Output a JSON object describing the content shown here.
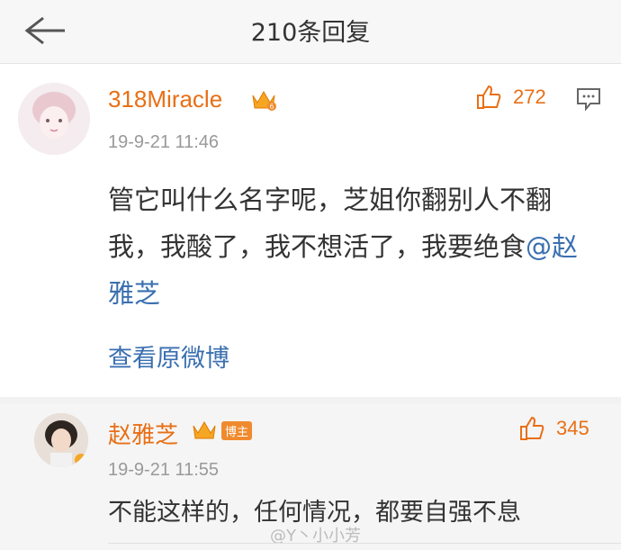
{
  "header": {
    "title": "210条回复",
    "back_icon": "back-arrow-icon"
  },
  "comment1": {
    "username": "318Miracle",
    "time": "19-9-21 11:46",
    "like_count": "272",
    "text": "管它叫什么名字呢，芝姐你翻别人不翻我，我酸了，我不想活了，我要绝食",
    "mention": "@赵雅芝",
    "view_original": "查看原微博",
    "vip_badge": "6"
  },
  "comment2": {
    "username": "赵雅芝",
    "badge": "博主",
    "time": "19-9-21 11:55",
    "like_count": "345",
    "text": "不能这样的，任何情况，都要自强不息"
  },
  "watermark": "@Y丶小小芳",
  "colors": {
    "accent": "#e86f16",
    "link": "#3a6fb0",
    "muted": "#999999"
  }
}
